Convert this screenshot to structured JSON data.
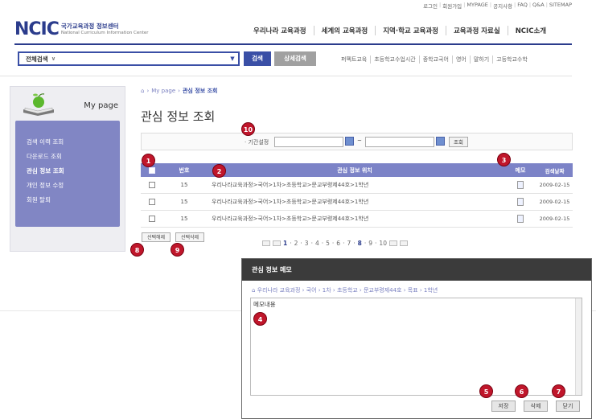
{
  "util_links": [
    "로그인",
    "회원가입",
    "MYPAGE",
    "공지사항",
    "FAQ",
    "Q&A",
    "SITEMAP"
  ],
  "logo": {
    "mark": "NCIC",
    "kr": "국가교육과정 정보센터",
    "en": "National Curriculum Information Center"
  },
  "gnb": [
    "우리나라 교육과정",
    "세계의 교육과정",
    "지역·학교 교육과정",
    "교육과정 자료실",
    "NCIC소개"
  ],
  "search": {
    "scope": "전체검색",
    "search_btn": "검색",
    "detail_btn": "상세검색"
  },
  "quick_links": [
    "퍼펙트교육",
    "초등학교수업시간",
    "중학교국어",
    "영어",
    "말하기",
    "고등학교수학"
  ],
  "sidebar": {
    "title": "My page",
    "items": [
      {
        "label": "검색 이력 조회",
        "active": false
      },
      {
        "label": "다운로드 조회",
        "active": false
      },
      {
        "label": "관심 정보 조회",
        "active": true
      },
      {
        "label": "개인 정보 수정",
        "active": false
      },
      {
        "label": "회원 탈퇴",
        "active": false
      }
    ]
  },
  "breadcrumb": {
    "home_icon": "home-icon",
    "parent": "My page",
    "current": "관심 정보 조회"
  },
  "page_title": "관심 정보 조회",
  "period": {
    "label": "· 기간설정",
    "from": "",
    "to": "",
    "tilde": "~",
    "search_btn": "조회"
  },
  "table": {
    "headers": {
      "no": "번호",
      "location": "관심 정보 위치",
      "memo": "메모",
      "date": "검색날짜"
    },
    "rows": [
      {
        "no": "15",
        "location": "우리나라교육과정>국어>1차>초등학교>문교부령제44호>1학년",
        "date": "2009-02-15"
      },
      {
        "no": "15",
        "location": "우리나라교육과정>국어>1차>초등학교>문교부령제44호>1학년",
        "date": "2009-02-15"
      },
      {
        "no": "15",
        "location": "우리나라교육과정>국어>1차>초등학교>문교부령제44호>1학년",
        "date": "2009-02-15"
      }
    ]
  },
  "buttons": {
    "deselect": "선택해제",
    "delete_selected": "선택삭제"
  },
  "pager": {
    "pages": [
      "1",
      "2",
      "3",
      "4",
      "5",
      "6",
      "7",
      "8",
      "9",
      "10"
    ],
    "current": "1",
    "highlight": "8"
  },
  "popup": {
    "title": "관심 정보 메모",
    "crumb": "우리나라 교육과정 › 국어 › 1차 › 초등학교 › 문교부령제44호 › 목표 › 1학년",
    "memo_value": "메모내용",
    "save": "저장",
    "delete": "삭제",
    "close": "닫기"
  },
  "callouts": [
    "1",
    "2",
    "3",
    "4",
    "5",
    "6",
    "7",
    "8",
    "9",
    "10"
  ],
  "colors": {
    "brand": "#2b3c8c",
    "menu_bg": "#8186c4",
    "table_head": "#7c83c7",
    "callout": "#c0162b",
    "popup_title": "#3b3b3b"
  }
}
